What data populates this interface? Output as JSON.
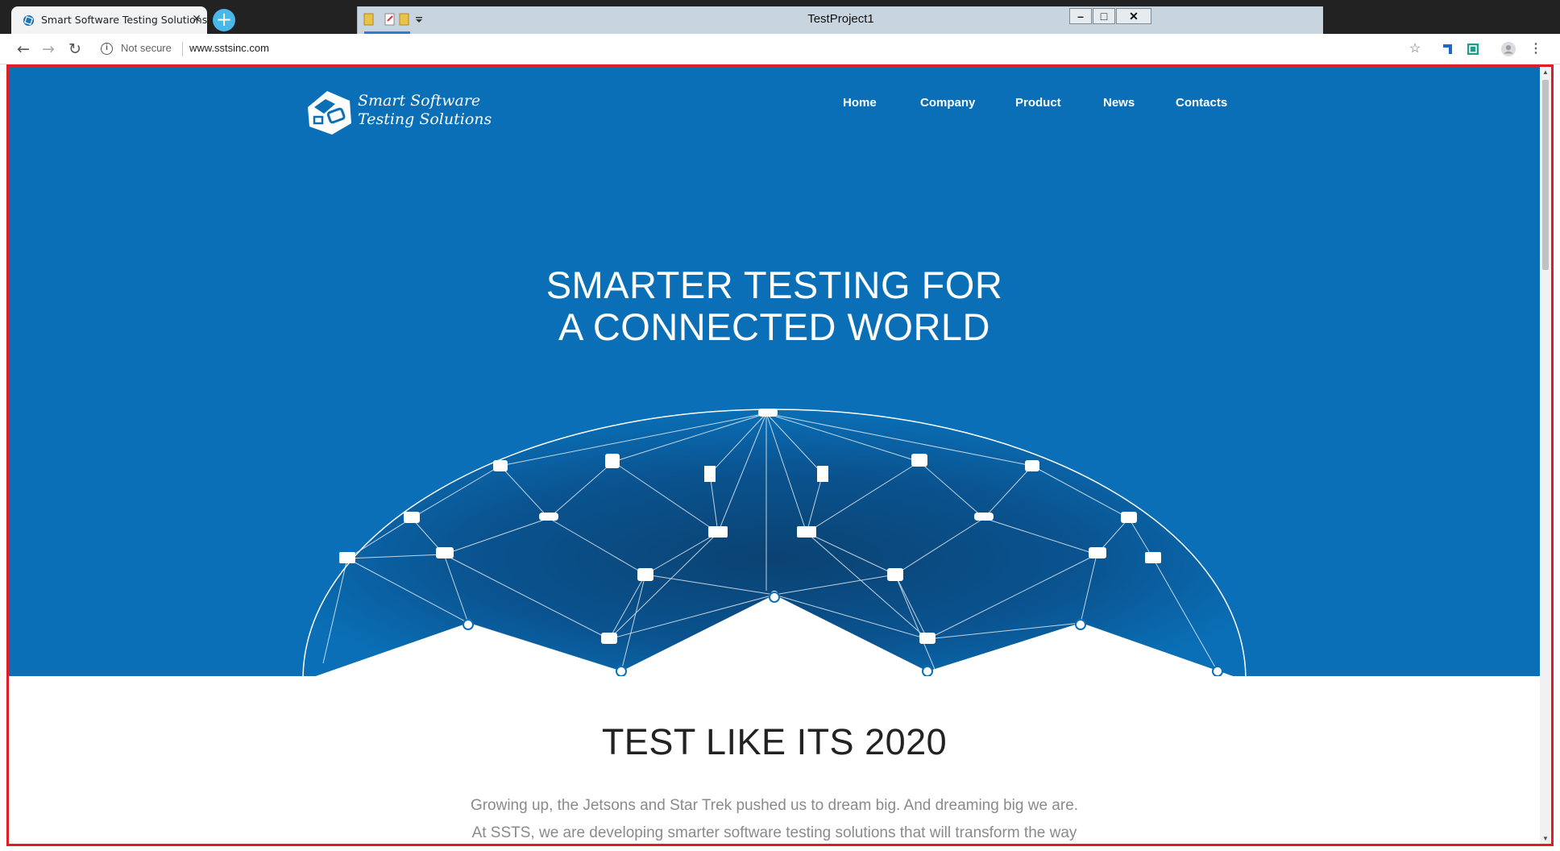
{
  "browser": {
    "tab_title": "Smart Software Testing Solutions",
    "tab_close": "✕",
    "new_tab": "+",
    "security_label": "Not secure",
    "url": "www.sstsinc.com"
  },
  "app": {
    "title": "TestProject1",
    "minimize": "–",
    "maximize": "□",
    "close": "✕"
  },
  "site": {
    "logo_line1": "Smart Software",
    "logo_line2": "Testing Solutions",
    "nav": [
      "Home",
      "Company",
      "Product",
      "News",
      "Contacts"
    ],
    "headline_line1": "SMARTER TESTING FOR",
    "headline_line2": "A CONNECTED WORLD",
    "section_title": "TEST LIKE ITS 2020",
    "section_body_line1": "Growing up, the Jetsons and Star Trek pushed us to dream big. And dreaming big we are.",
    "section_body_line2": "At SSTS, we are developing smarter software testing solutions that will transform the way"
  },
  "colors": {
    "hero_blue": "#0a6fb6",
    "highlight_border": "#e01d25",
    "titlebar": "#222222",
    "new_tab": "#49b8e8"
  }
}
